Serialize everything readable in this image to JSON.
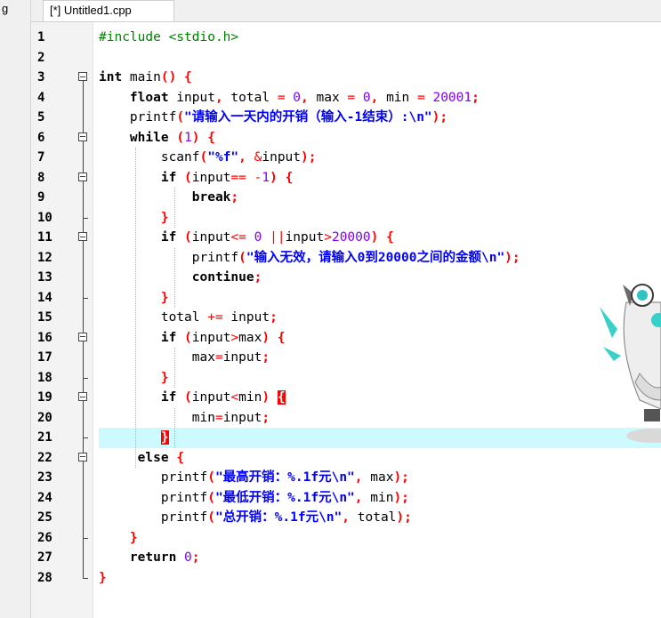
{
  "left_panel": {
    "fragment": "g"
  },
  "tab": {
    "title": "[*] Untitled1.cpp"
  },
  "highlight_line": 21,
  "lines": [
    {
      "n": "1",
      "fold": "none",
      "tokens": [
        [
          "pp",
          "#include <stdio.h>"
        ]
      ]
    },
    {
      "n": "2",
      "fold": "none",
      "tokens": []
    },
    {
      "n": "3",
      "fold": "open",
      "tokens": [
        [
          "kw",
          "int"
        ],
        [
          "t",
          " main"
        ],
        [
          "br",
          "() {"
        ]
      ]
    },
    {
      "n": "4",
      "fold": "bar",
      "tokens": [
        [
          "t",
          "    "
        ],
        [
          "kw",
          "float"
        ],
        [
          "t",
          " input"
        ],
        [
          "br",
          ","
        ],
        [
          "t",
          " total "
        ],
        [
          "op",
          "="
        ],
        [
          "t",
          " "
        ],
        [
          "num",
          "0"
        ],
        [
          "br",
          ","
        ],
        [
          "t",
          " max "
        ],
        [
          "op",
          "="
        ],
        [
          "t",
          " "
        ],
        [
          "num",
          "0"
        ],
        [
          "br",
          ","
        ],
        [
          "t",
          " min "
        ],
        [
          "op",
          "="
        ],
        [
          "t",
          " "
        ],
        [
          "num",
          "20001"
        ],
        [
          "br",
          ";"
        ]
      ]
    },
    {
      "n": "5",
      "fold": "bar",
      "tokens": [
        [
          "t",
          "    printf"
        ],
        [
          "br",
          "("
        ],
        [
          "str",
          "\"请输入一天内的开销（输入-1结束）:\\n\""
        ],
        [
          "br",
          ");"
        ]
      ]
    },
    {
      "n": "6",
      "fold": "open",
      "tokens": [
        [
          "t",
          "    "
        ],
        [
          "kw",
          "while"
        ],
        [
          "t",
          " "
        ],
        [
          "br",
          "("
        ],
        [
          "num",
          "1"
        ],
        [
          "br",
          ") {"
        ]
      ]
    },
    {
      "n": "7",
      "fold": "bar",
      "tokens": [
        [
          "t",
          "        scanf"
        ],
        [
          "br",
          "("
        ],
        [
          "str",
          "\"%f\""
        ],
        [
          "br",
          ","
        ],
        [
          "t",
          " "
        ],
        [
          "op",
          "&"
        ],
        [
          "t",
          "input"
        ],
        [
          "br",
          ");"
        ]
      ]
    },
    {
      "n": "8",
      "fold": "open",
      "tokens": [
        [
          "t",
          "        "
        ],
        [
          "kw",
          "if"
        ],
        [
          "t",
          " "
        ],
        [
          "br",
          "("
        ],
        [
          "t",
          "input"
        ],
        [
          "op",
          "=="
        ],
        [
          "t",
          " "
        ],
        [
          "op",
          "-"
        ],
        [
          "num",
          "1"
        ],
        [
          "br",
          ") {"
        ]
      ]
    },
    {
      "n": "9",
      "fold": "bar",
      "tokens": [
        [
          "t",
          "            "
        ],
        [
          "kw",
          "break"
        ],
        [
          "br",
          ";"
        ]
      ]
    },
    {
      "n": "10",
      "fold": "end",
      "tokens": [
        [
          "t",
          "        "
        ],
        [
          "br",
          "}"
        ]
      ]
    },
    {
      "n": "11",
      "fold": "open",
      "tokens": [
        [
          "t",
          "        "
        ],
        [
          "kw",
          "if"
        ],
        [
          "t",
          " "
        ],
        [
          "br",
          "("
        ],
        [
          "t",
          "input"
        ],
        [
          "op",
          "<="
        ],
        [
          "t",
          " "
        ],
        [
          "num",
          "0"
        ],
        [
          "t",
          " "
        ],
        [
          "op",
          "||"
        ],
        [
          "t",
          "input"
        ],
        [
          "op",
          ">"
        ],
        [
          "num",
          "20000"
        ],
        [
          "br",
          ") {"
        ]
      ]
    },
    {
      "n": "12",
      "fold": "bar",
      "tokens": [
        [
          "t",
          "            printf"
        ],
        [
          "br",
          "("
        ],
        [
          "str",
          "\"输入无效，请输入0到20000之间的金额\\n\""
        ],
        [
          "br",
          ");"
        ]
      ]
    },
    {
      "n": "13",
      "fold": "bar",
      "tokens": [
        [
          "t",
          "            "
        ],
        [
          "kw",
          "continue"
        ],
        [
          "br",
          ";"
        ]
      ]
    },
    {
      "n": "14",
      "fold": "end",
      "tokens": [
        [
          "t",
          "        "
        ],
        [
          "br",
          "}"
        ]
      ]
    },
    {
      "n": "15",
      "fold": "bar",
      "tokens": [
        [
          "t",
          "        total "
        ],
        [
          "op",
          "+="
        ],
        [
          "t",
          " input"
        ],
        [
          "br",
          ";"
        ]
      ]
    },
    {
      "n": "16",
      "fold": "open",
      "tokens": [
        [
          "t",
          "        "
        ],
        [
          "kw",
          "if"
        ],
        [
          "t",
          " "
        ],
        [
          "br",
          "("
        ],
        [
          "t",
          "input"
        ],
        [
          "op",
          ">"
        ],
        [
          "t",
          "max"
        ],
        [
          "br",
          ") {"
        ]
      ]
    },
    {
      "n": "17",
      "fold": "bar",
      "tokens": [
        [
          "t",
          "            max"
        ],
        [
          "op",
          "="
        ],
        [
          "t",
          "input"
        ],
        [
          "br",
          ";"
        ]
      ]
    },
    {
      "n": "18",
      "fold": "end",
      "tokens": [
        [
          "t",
          "        "
        ],
        [
          "br",
          "}"
        ]
      ]
    },
    {
      "n": "19",
      "fold": "open",
      "tokens": [
        [
          "t",
          "        "
        ],
        [
          "kw",
          "if"
        ],
        [
          "t",
          " "
        ],
        [
          "br",
          "("
        ],
        [
          "t",
          "input"
        ],
        [
          "op",
          "<"
        ],
        [
          "t",
          "min"
        ],
        [
          "br",
          ") "
        ],
        [
          "brh",
          "{"
        ]
      ]
    },
    {
      "n": "20",
      "fold": "bar",
      "tokens": [
        [
          "t",
          "            min"
        ],
        [
          "op",
          "="
        ],
        [
          "t",
          "input"
        ],
        [
          "br",
          ";"
        ]
      ]
    },
    {
      "n": "21",
      "fold": "end",
      "tokens": [
        [
          "t",
          "        "
        ],
        [
          "brh",
          "}"
        ]
      ]
    },
    {
      "n": "22",
      "fold": "open",
      "tokens": [
        [
          "t",
          "     "
        ],
        [
          "kw",
          "else"
        ],
        [
          "t",
          " "
        ],
        [
          "br",
          "{"
        ]
      ]
    },
    {
      "n": "23",
      "fold": "bar",
      "tokens": [
        [
          "t",
          "        printf"
        ],
        [
          "br",
          "("
        ],
        [
          "str",
          "\"最高开销：%.1f元\\n\""
        ],
        [
          "br",
          ","
        ],
        [
          "t",
          " max"
        ],
        [
          "br",
          ");"
        ]
      ]
    },
    {
      "n": "24",
      "fold": "bar",
      "tokens": [
        [
          "t",
          "        printf"
        ],
        [
          "br",
          "("
        ],
        [
          "str",
          "\"最低开销：%.1f元\\n\""
        ],
        [
          "br",
          ","
        ],
        [
          "t",
          " min"
        ],
        [
          "br",
          ");"
        ]
      ]
    },
    {
      "n": "25",
      "fold": "bar",
      "tokens": [
        [
          "t",
          "        printf"
        ],
        [
          "br",
          "("
        ],
        [
          "str",
          "\"总开销：%.1f元\\n\""
        ],
        [
          "br",
          ","
        ],
        [
          "t",
          " total"
        ],
        [
          "br",
          ");"
        ]
      ]
    },
    {
      "n": "26",
      "fold": "end",
      "tokens": [
        [
          "t",
          "    "
        ],
        [
          "br",
          "}"
        ]
      ]
    },
    {
      "n": "27",
      "fold": "bar",
      "tokens": [
        [
          "t",
          "    "
        ],
        [
          "kw",
          "return"
        ],
        [
          "t",
          " "
        ],
        [
          "num",
          "0"
        ],
        [
          "br",
          ";"
        ]
      ]
    },
    {
      "n": "28",
      "fold": "last",
      "tokens": [
        [
          "br",
          "}"
        ]
      ]
    }
  ]
}
